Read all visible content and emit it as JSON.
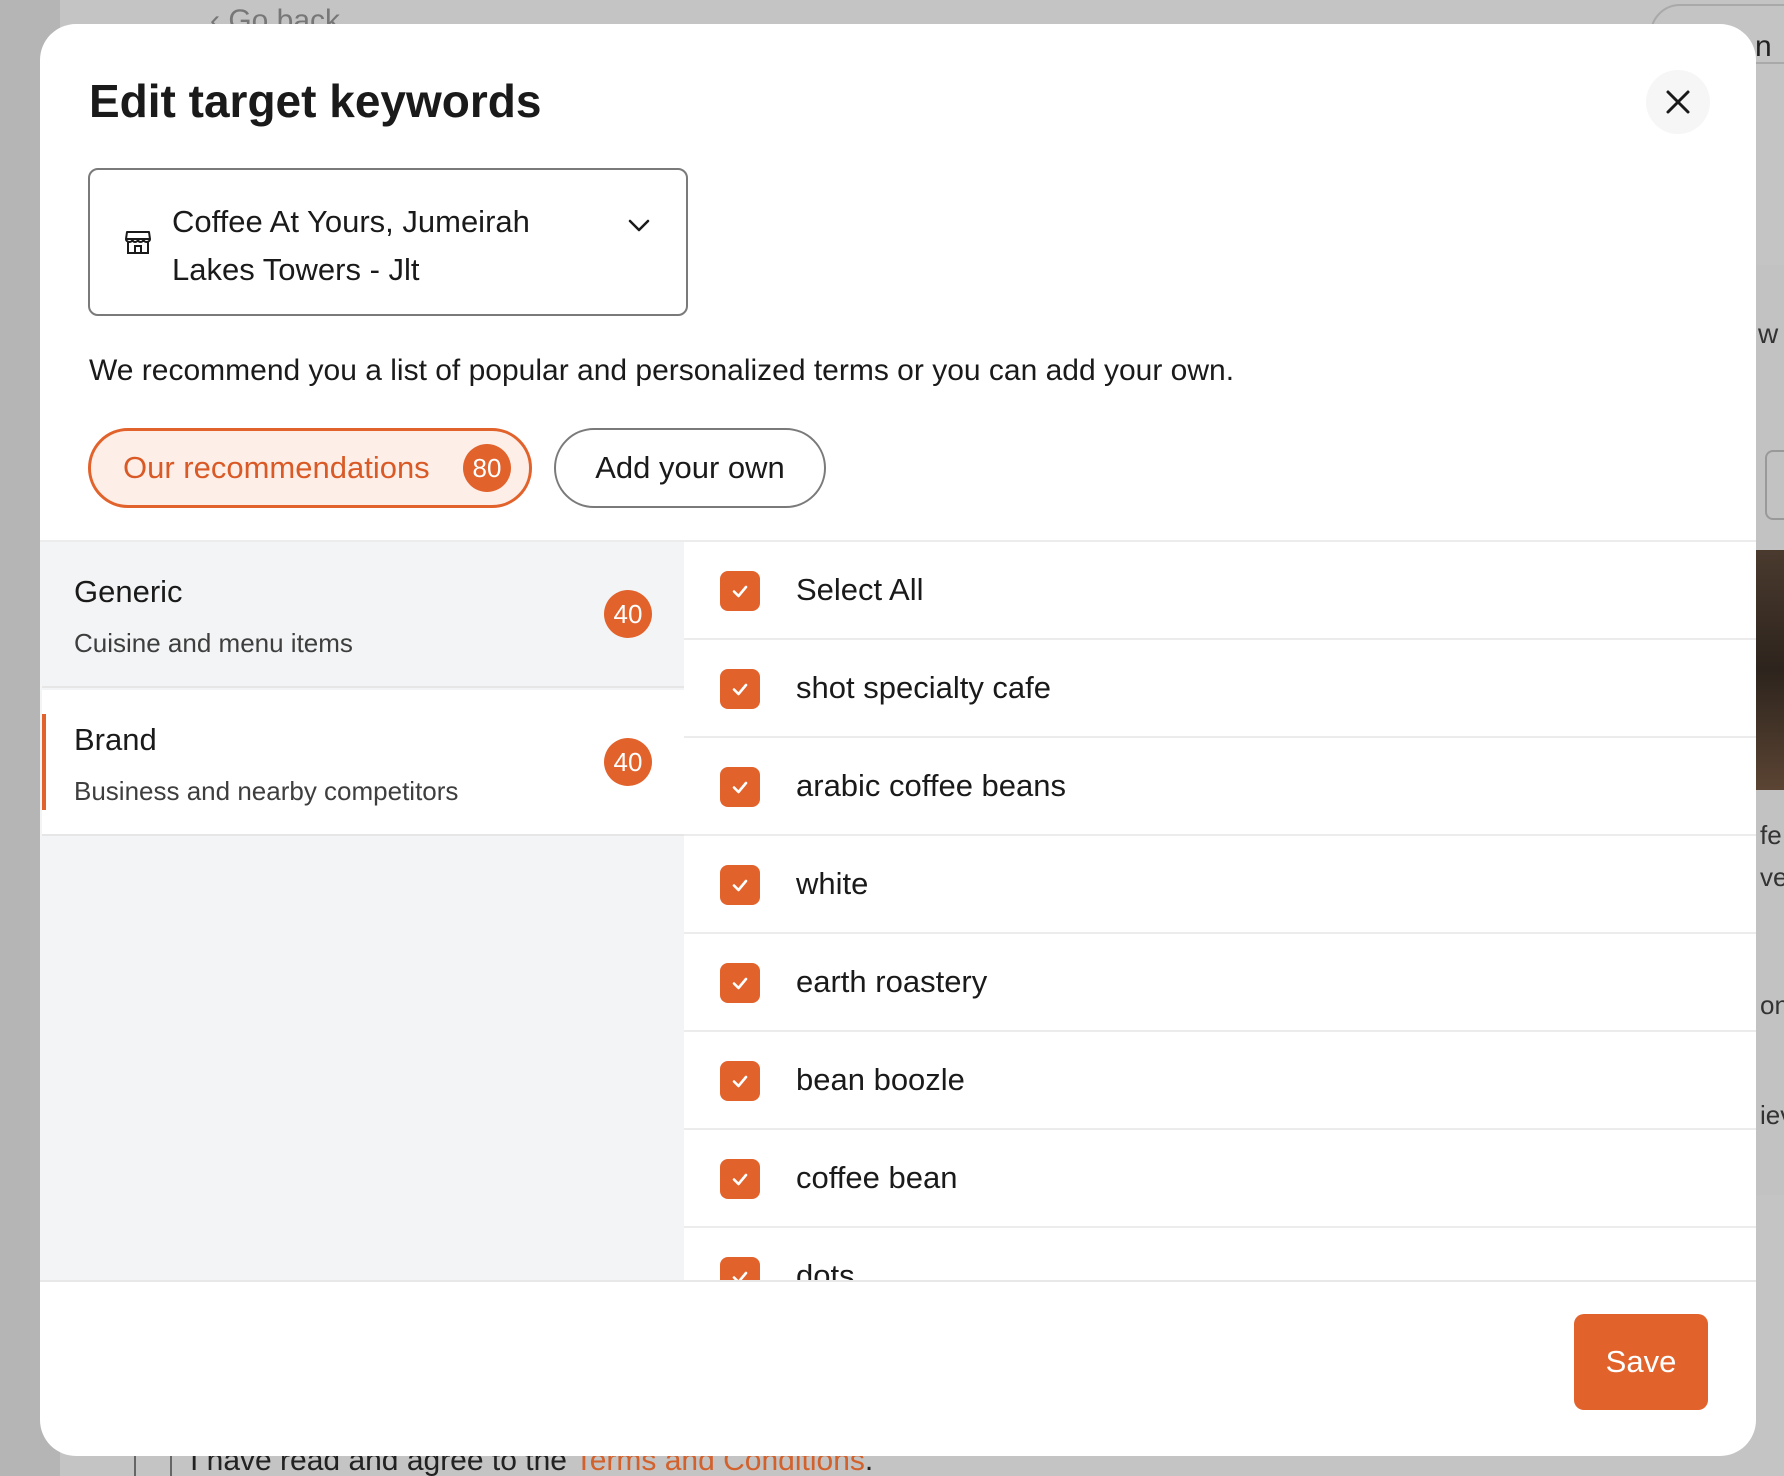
{
  "background": {
    "go_back": "‹ Go back",
    "corner_fragment": "n",
    "side_fragment_w": "w",
    "side_fragments": [
      "fe",
      "ver",
      "ont",
      "iev"
    ],
    "terms_prefix": "I have read and agree to the ",
    "terms_link": "Terms and Conditions",
    "terms_suffix": "."
  },
  "modal": {
    "title": "Edit target keywords",
    "close_icon": "close-icon",
    "store_select": {
      "value": "Coffee At Yours, Jumeirah Lakes Towers - Jlt",
      "icon": "store-icon"
    },
    "intro": "We recommend you a list of popular and personalized terms or you can add your own.",
    "tabs": [
      {
        "label": "Our recommendations",
        "count": "80",
        "active": true
      },
      {
        "label": "Add your own",
        "active": false
      }
    ],
    "categories": [
      {
        "title": "Generic",
        "subtitle": "Cuisine and menu items",
        "count": "40"
      },
      {
        "title": "Brand",
        "subtitle": "Business and nearby competitors",
        "count": "40"
      }
    ],
    "keywords": [
      {
        "label": "Select All",
        "checked": true
      },
      {
        "label": "shot specialty cafe",
        "checked": true
      },
      {
        "label": "arabic coffee beans",
        "checked": true
      },
      {
        "label": "white",
        "checked": true
      },
      {
        "label": "earth roastery",
        "checked": true
      },
      {
        "label": "bean boozle",
        "checked": true
      },
      {
        "label": "coffee bean",
        "checked": true
      },
      {
        "label": "dots",
        "checked": true
      }
    ],
    "save_label": "Save",
    "accent_color": "#e2622c"
  }
}
